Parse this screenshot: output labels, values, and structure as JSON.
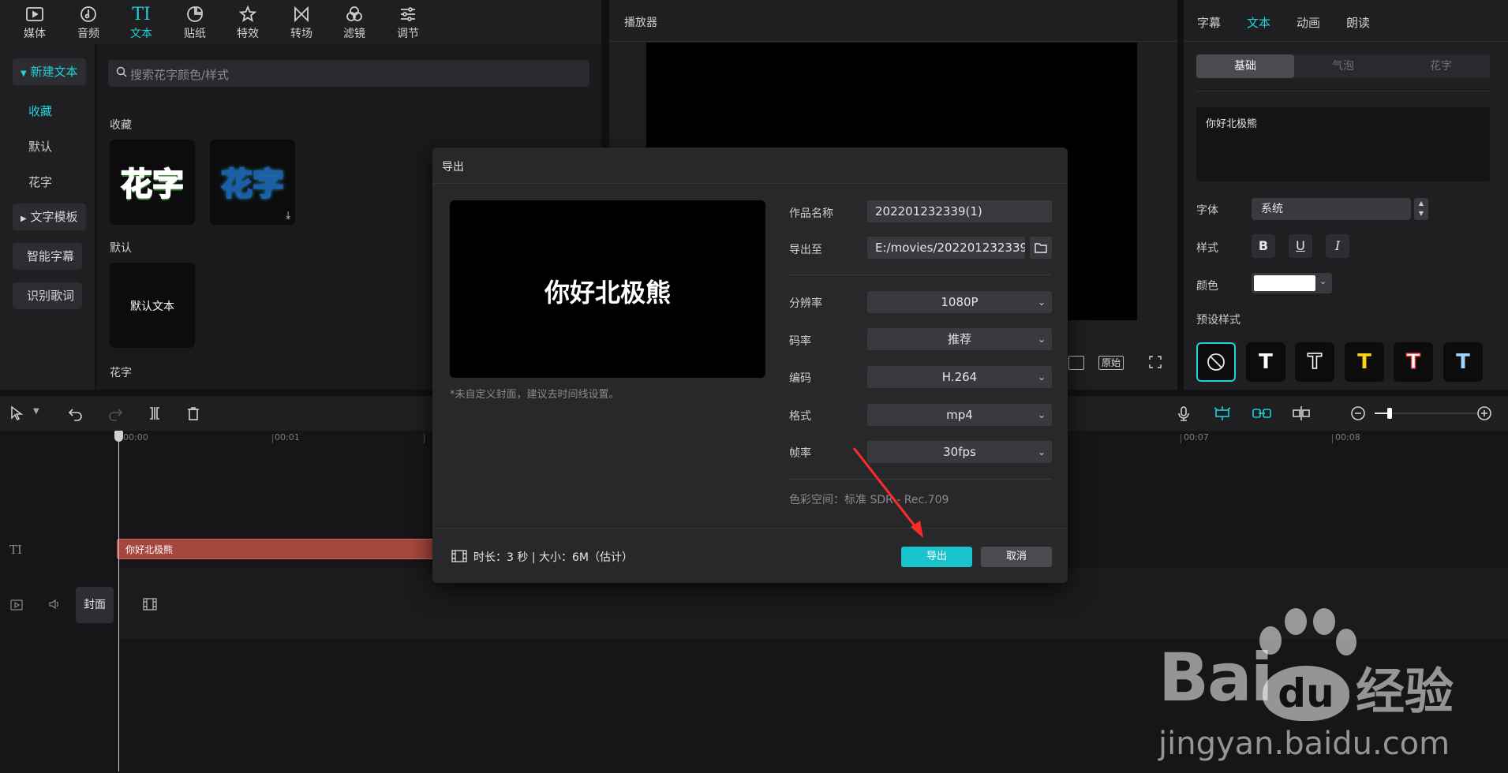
{
  "toolbar": {
    "items": [
      {
        "label": "媒体",
        "icon": "media-icon"
      },
      {
        "label": "音频",
        "icon": "audio-icon"
      },
      {
        "label": "文本",
        "icon": "text-icon",
        "active": true
      },
      {
        "label": "贴纸",
        "icon": "sticker-icon"
      },
      {
        "label": "特效",
        "icon": "effects-icon"
      },
      {
        "label": "转场",
        "icon": "transition-icon"
      },
      {
        "label": "滤镜",
        "icon": "filter-icon"
      },
      {
        "label": "调节",
        "icon": "adjust-icon"
      }
    ],
    "text_icon_glyph": "TI"
  },
  "leftnav": {
    "new_text": "新建文本",
    "favorites": "收藏",
    "default": "默认",
    "fancy": "花字",
    "text_template": "文字模板",
    "smart_caption": "智能字幕",
    "lyrics": "识别歌词"
  },
  "library": {
    "search_placeholder": "搜索花字颜色/样式",
    "section_favorites": "收藏",
    "card_text": "花字",
    "section_default": "默认",
    "default_card": "默认文本",
    "section_fancy": "花字"
  },
  "player": {
    "title": "播放器",
    "btn_original": "原始"
  },
  "right": {
    "tabs": [
      "字幕",
      "文本",
      "动画",
      "朗读"
    ],
    "active_tab": 1,
    "subtabs": [
      "基础",
      "气泡",
      "花字"
    ],
    "text_value": "你好北极熊",
    "font_label": "字体",
    "font_value": "系统",
    "style_label": "样式",
    "style_b": "B",
    "style_u": "U",
    "style_i": "I",
    "color_label": "颜色",
    "preset_label": "预设样式",
    "preset_glyph": "T"
  },
  "timeline": {
    "ticks": [
      "00:00",
      "00:01",
      "00:07",
      "00:08"
    ],
    "text_track_icon": "TI",
    "clip_label": "你好北极熊",
    "cover_label": "封面"
  },
  "dialog": {
    "title": "导出",
    "preview_text": "你好北极熊",
    "cover_hint": "*未自定义封面，建议去时间线设置。",
    "name_label": "作品名称",
    "name_value": "202201232339(1)",
    "path_label": "导出至",
    "path_value": "E:/movies/202201232339...",
    "resolution_label": "分辨率",
    "resolution_value": "1080P",
    "bitrate_label": "码率",
    "bitrate_value": "推荐",
    "codec_label": "编码",
    "codec_value": "H.264",
    "format_label": "格式",
    "format_value": "mp4",
    "fps_label": "帧率",
    "fps_value": "30fps",
    "colorspace": "色彩空间：标准 SDR - Rec.709",
    "footer_info": "时长：3 秒 | 大小：6M（估计）",
    "export_button": "导出",
    "cancel_button": "取消"
  },
  "watermark": {
    "brand_left": "Bai",
    "brand_mid": "du",
    "brand_right": "经验",
    "url": "jingyan.baidu.com"
  },
  "colors": {
    "accent": "#21d0d8",
    "clip": "#a6473d",
    "annotation_arrow": "#ff2a2a"
  }
}
